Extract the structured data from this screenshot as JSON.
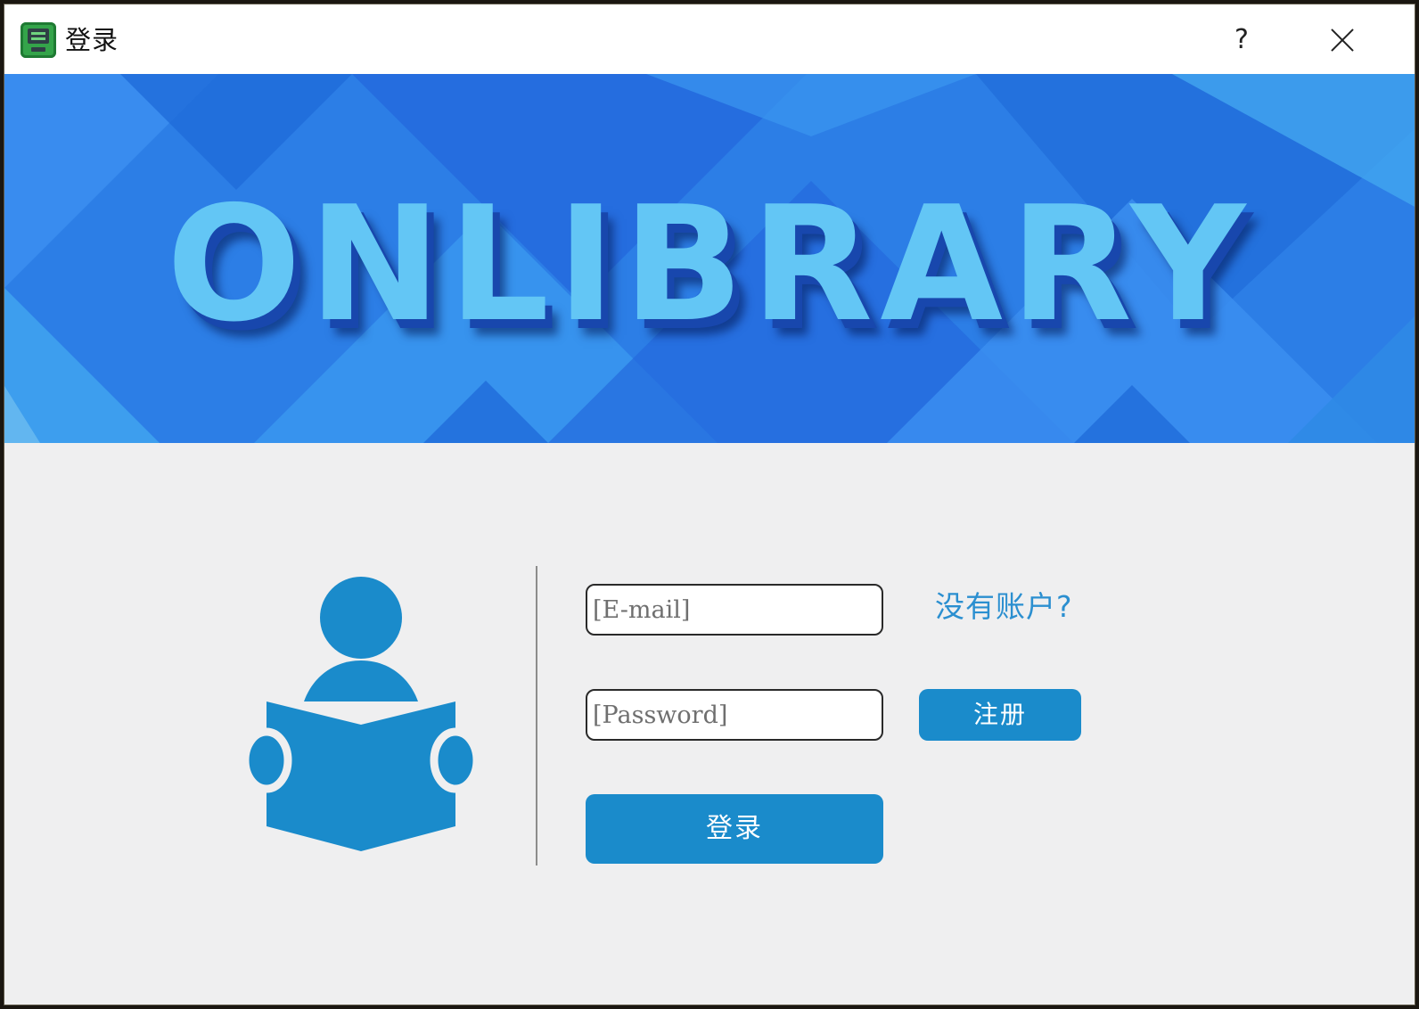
{
  "window": {
    "title": "登录",
    "help_label": "?",
    "icons": {
      "app": "app-icon",
      "close": "close-icon"
    }
  },
  "banner": {
    "logo_text": "ONLIBRARY",
    "colors": {
      "background": "#2f7fe7",
      "logo": "#63c6f5",
      "shadow": "#1847ad"
    }
  },
  "form": {
    "email_placeholder": "[E-mail]",
    "password_placeholder": "[Password]",
    "no_account_link": "没有账户?",
    "register_button": "注册",
    "login_button": "登录"
  },
  "illustration": {
    "icon": "reader-icon",
    "color": "#1a8bcb"
  },
  "colors": {
    "accent": "#1a8bcb",
    "link": "#2b8fd0",
    "background": "#efeff0"
  }
}
